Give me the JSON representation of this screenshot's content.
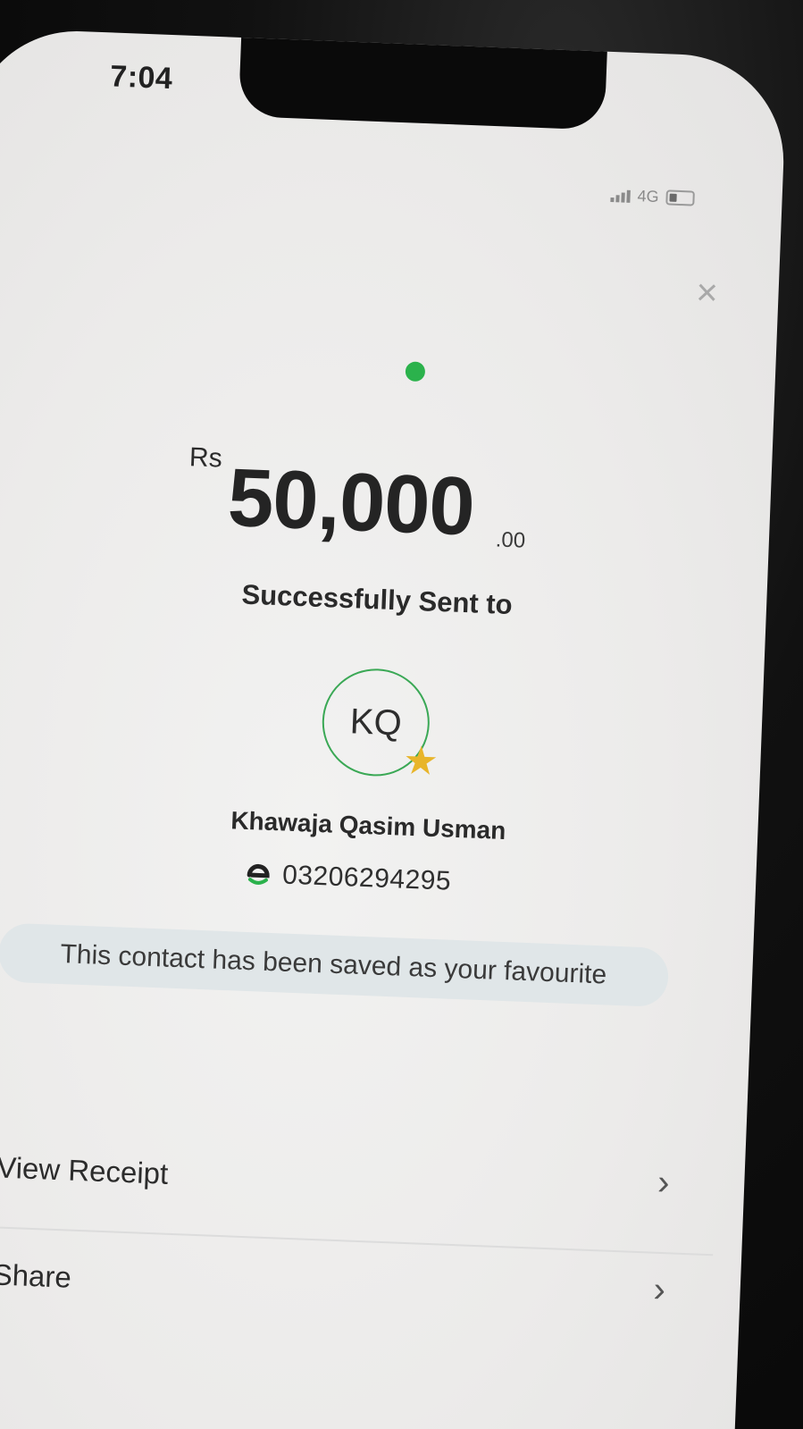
{
  "status_bar": {
    "time": "7:04",
    "network": "4G"
  },
  "transaction": {
    "currency": "Rs",
    "amount": "50,000",
    "decimal": ".00",
    "status_text": "Successfully Sent to"
  },
  "recipient": {
    "initials": "KQ",
    "name": "Khawaja Qasim Usman",
    "phone": "03206294295"
  },
  "favourite_message": "This contact has been saved as your favourite",
  "actions": [
    {
      "label": "View Receipt"
    },
    {
      "label": "Share"
    }
  ],
  "colors": {
    "success": "#2bb24c",
    "favourite_star": "#e8b52a",
    "avatar_border": "#3aa855"
  },
  "icons": {
    "close": "close-icon",
    "star": "star-icon",
    "wallet": "wallet-icon",
    "chevron": "chevron-right-icon"
  }
}
